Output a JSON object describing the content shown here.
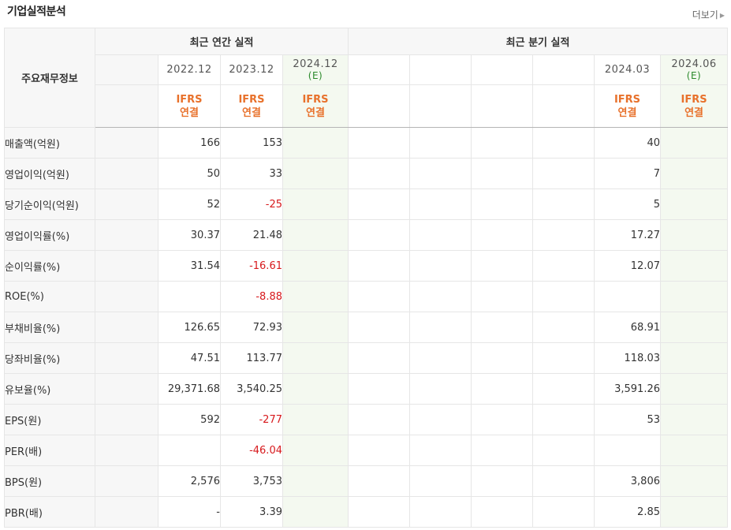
{
  "header": {
    "title": "기업실적분석",
    "more_label": "더보기"
  },
  "table": {
    "corner_label": "주요재무정보",
    "annual_group": "최근 연간 실적",
    "quarter_group": "최근 분기 실적",
    "periods": [
      "",
      "2022.12",
      "2023.12",
      "2024.12",
      "",
      "",
      "",
      "",
      "2024.03",
      "2024.06"
    ],
    "estimate_mark": "(E)",
    "ifrs_top": "IFRS",
    "ifrs_bottom": "연결",
    "rows": [
      {
        "label": "매출액(억원)",
        "cells": [
          "",
          "166",
          "153",
          "",
          "",
          "",
          "",
          "",
          "40",
          ""
        ]
      },
      {
        "label": "영업이익(억원)",
        "cells": [
          "",
          "50",
          "33",
          "",
          "",
          "",
          "",
          "",
          "7",
          ""
        ]
      },
      {
        "label": "당기순이익(억원)",
        "cells": [
          "",
          "52",
          "-25",
          "",
          "",
          "",
          "",
          "",
          "5",
          ""
        ]
      },
      {
        "label": "영업이익률(%)",
        "cells": [
          "",
          "30.37",
          "21.48",
          "",
          "",
          "",
          "",
          "",
          "17.27",
          ""
        ]
      },
      {
        "label": "순이익률(%)",
        "cells": [
          "",
          "31.54",
          "-16.61",
          "",
          "",
          "",
          "",
          "",
          "12.07",
          ""
        ]
      },
      {
        "label": "ROE(%)",
        "cells": [
          "",
          "",
          "-8.88",
          "",
          "",
          "",
          "",
          "",
          "",
          ""
        ]
      },
      {
        "label": "부채비율(%)",
        "cells": [
          "",
          "126.65",
          "72.93",
          "",
          "",
          "",
          "",
          "",
          "68.91",
          ""
        ]
      },
      {
        "label": "당좌비율(%)",
        "cells": [
          "",
          "47.51",
          "113.77",
          "",
          "",
          "",
          "",
          "",
          "118.03",
          ""
        ]
      },
      {
        "label": "유보율(%)",
        "cells": [
          "",
          "29,371.68",
          "3,540.25",
          "",
          "",
          "",
          "",
          "",
          "3,591.26",
          ""
        ]
      },
      {
        "label": "EPS(원)",
        "cells": [
          "",
          "592",
          "-277",
          "",
          "",
          "",
          "",
          "",
          "53",
          ""
        ]
      },
      {
        "label": "PER(배)",
        "cells": [
          "",
          "",
          "-46.04",
          "",
          "",
          "",
          "",
          "",
          "",
          ""
        ]
      },
      {
        "label": "BPS(원)",
        "cells": [
          "",
          "2,576",
          "3,753",
          "",
          "",
          "",
          "",
          "",
          "3,806",
          ""
        ]
      },
      {
        "label": "PBR(배)",
        "cells": [
          "",
          "-",
          "3.39",
          "",
          "",
          "",
          "",
          "",
          "2.85",
          ""
        ]
      }
    ]
  },
  "colors": {
    "negative": "#d7191c",
    "ifrs": "#e8712b",
    "estimate_bg": "#f4f9f0",
    "estimate_text": "#2c8a2c"
  }
}
